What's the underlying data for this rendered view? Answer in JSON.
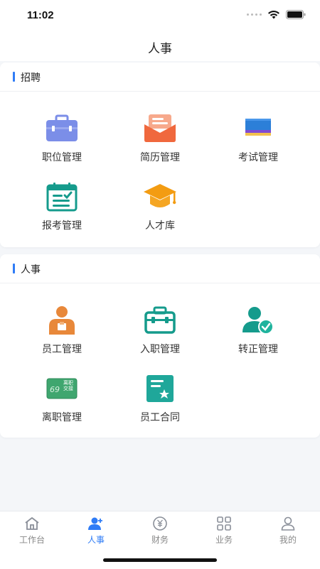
{
  "status_bar": {
    "time": "11:02"
  },
  "header": {
    "title": "人事"
  },
  "sections": [
    {
      "title": "招聘",
      "items": [
        {
          "label": "职位管理",
          "icon": "briefcase-icon"
        },
        {
          "label": "简历管理",
          "icon": "resume-envelope-icon"
        },
        {
          "label": "考试管理",
          "icon": "exam-card-icon"
        },
        {
          "label": "报考管理",
          "icon": "calendar-check-icon"
        },
        {
          "label": "人才库",
          "icon": "graduation-cap-icon"
        }
      ]
    },
    {
      "title": "人事",
      "items": [
        {
          "label": "员工管理",
          "icon": "employee-icon"
        },
        {
          "label": "入职管理",
          "icon": "toolbox-icon"
        },
        {
          "label": "转正管理",
          "icon": "user-check-icon"
        },
        {
          "label": "离职管理",
          "icon": "resignation-card-icon",
          "badge_text": "离职\n交接"
        },
        {
          "label": "员工合同",
          "icon": "contract-icon"
        }
      ]
    }
  ],
  "tabbar": {
    "items": [
      {
        "label": "工作台",
        "icon": "home-icon",
        "active": false
      },
      {
        "label": "人事",
        "icon": "add-user-icon",
        "active": true
      },
      {
        "label": "财务",
        "icon": "yuan-coin-icon",
        "active": false
      },
      {
        "label": "业务",
        "icon": "grid-icon",
        "active": false
      },
      {
        "label": "我的",
        "icon": "profile-icon",
        "active": false
      }
    ]
  },
  "colors": {
    "accent": "#2f7cf6",
    "briefcase": "#7b8ee8",
    "resume": "#f0683d",
    "exam": "#2c7fd8",
    "teal": "#159b8c",
    "cap": "#f39c12",
    "employee": "#e8883a"
  }
}
